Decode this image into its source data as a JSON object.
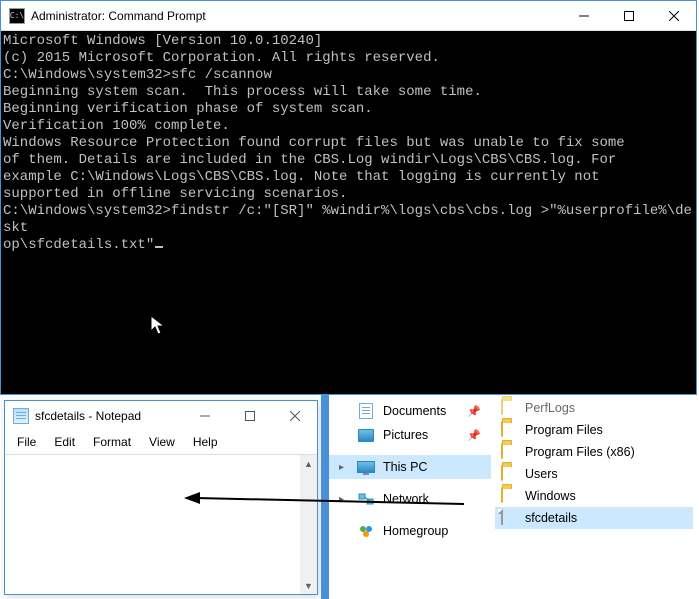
{
  "cmd": {
    "title": "Administrator: Command Prompt",
    "lines": [
      "Microsoft Windows [Version 10.0.10240]",
      "(c) 2015 Microsoft Corporation. All rights reserved.",
      "",
      "C:\\Windows\\system32>sfc /scannow",
      "",
      "Beginning system scan.  This process will take some time.",
      "",
      "Beginning verification phase of system scan.",
      "Verification 100% complete.",
      "",
      "Windows Resource Protection found corrupt files but was unable to fix some",
      "of them. Details are included in the CBS.Log windir\\Logs\\CBS\\CBS.log. For",
      "example C:\\Windows\\Logs\\CBS\\CBS.log. Note that logging is currently not",
      "supported in offline servicing scenarios.",
      "",
      "C:\\Windows\\system32>findstr /c:\"[SR]\" %windir%\\logs\\cbs\\cbs.log >\"%userprofile%\\deskt",
      "op\\sfcdetails.txt\""
    ]
  },
  "notepad": {
    "title": "sfcdetails - Notepad",
    "menu": {
      "file": "File",
      "edit": "Edit",
      "format": "Format",
      "view": "View",
      "help": "Help"
    }
  },
  "explorer": {
    "nav": {
      "documents": "Documents",
      "pictures": "Pictures",
      "thispc": "This PC",
      "network": "Network",
      "homegroup": "Homegroup"
    },
    "folders": {
      "perflogs": "PerfLogs",
      "programfiles": "Program Files",
      "programfilesx86": "Program Files (x86)",
      "users": "Users",
      "windows": "Windows",
      "sfcdetails": "sfcdetails"
    }
  }
}
